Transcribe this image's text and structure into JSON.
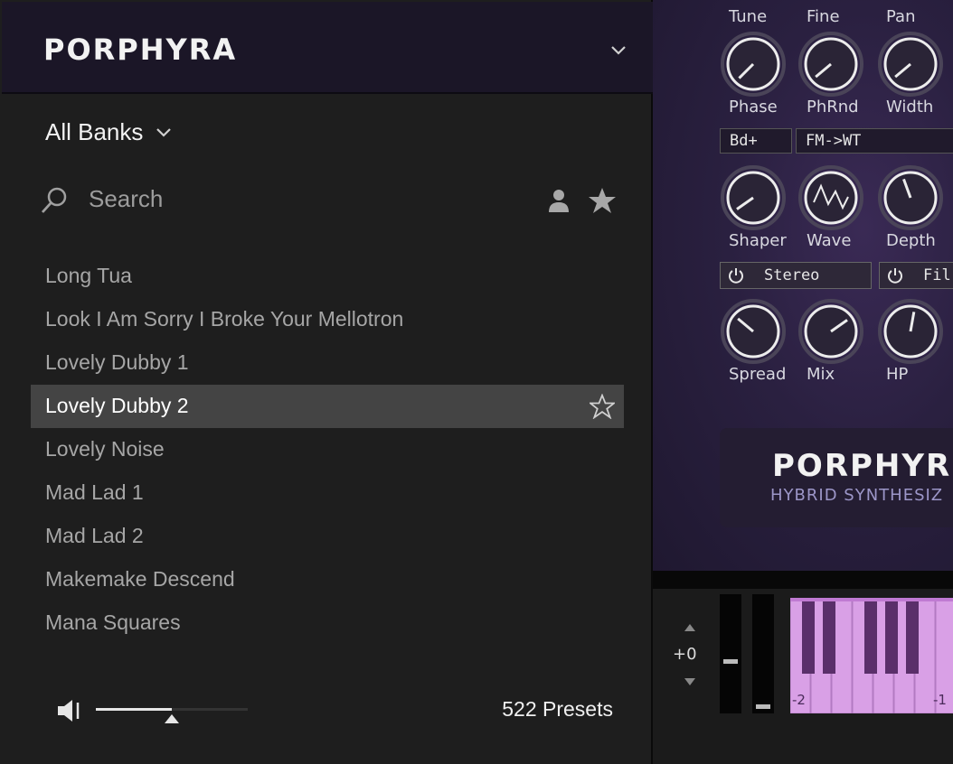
{
  "browser": {
    "logo": "PORPHYRA",
    "banks_label": "All Banks",
    "search_placeholder": "Search",
    "presets": [
      {
        "name": "Long Tua",
        "selected": false
      },
      {
        "name": "Look I Am Sorry I Broke Your Mellotron",
        "selected": false
      },
      {
        "name": "Lovely Dubby 1",
        "selected": false
      },
      {
        "name": "Lovely Dubby 2",
        "selected": true
      },
      {
        "name": "Lovely Noise",
        "selected": false
      },
      {
        "name": "Mad Lad 1",
        "selected": false
      },
      {
        "name": "Mad Lad 2",
        "selected": false
      },
      {
        "name": "Makemake Descend",
        "selected": false
      },
      {
        "name": "Mana Squares",
        "selected": false
      }
    ],
    "volume_level": 0.5,
    "preset_count": "522 Presets"
  },
  "synth": {
    "row1_labels": [
      "Tune",
      "Fine",
      "Pan"
    ],
    "row1_bottom_labels": [
      "Phase",
      "PhRnd",
      "Width"
    ],
    "mode_a": "Bd+",
    "mode_b": "FM->WT",
    "row2_labels": [
      "Shaper",
      "Wave",
      "Depth"
    ],
    "toggle_stereo": "Stereo",
    "toggle_filter": "Fil",
    "row3_labels": [
      "Spread",
      "Mix",
      "HP"
    ],
    "brand_logo": "PORPHYR",
    "brand_sub": "HYBRID SYNTHESIZ"
  },
  "keyboard": {
    "pitch_value": "+0",
    "octave_labels": [
      "-2",
      "-1"
    ]
  },
  "colors": {
    "accent": "#d9a0e6",
    "selected_row": "#444444",
    "header_bg": "#1b1627"
  }
}
